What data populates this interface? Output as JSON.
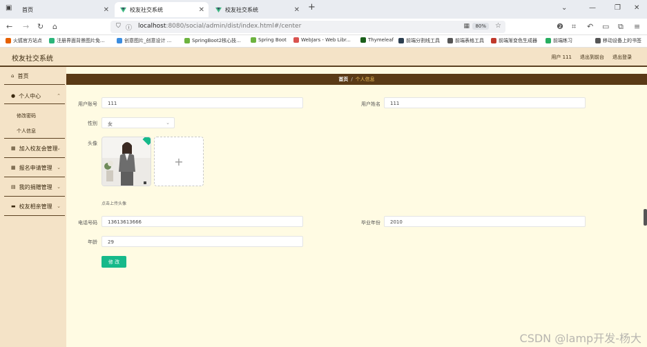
{
  "browser": {
    "tabs": [
      {
        "label": "首页"
      },
      {
        "label": "校友社交系统"
      },
      {
        "label": "校友社交系统"
      }
    ],
    "url_host": "localhost",
    "url_rest": ":8080/social/admin/dist/index.html#/center",
    "zoom": "80%",
    "bookmarks": [
      {
        "label": "火狐官方站点",
        "color": "#e66000"
      },
      {
        "label": "注册界面背景图片免...",
        "color": "#2bb57a"
      },
      {
        "label": "创意图片_创意设计 ...",
        "color": "#3b8de0"
      },
      {
        "label": "SpringBoot2核心技...",
        "color": "#6db33f"
      },
      {
        "label": "Spring Boot",
        "color": "#6db33f"
      },
      {
        "label": "WebJars - Web Libr...",
        "color": "#d9534f"
      },
      {
        "label": "Thymeleaf",
        "color": "#1a5f1a"
      },
      {
        "label": "前端分割线工具",
        "color": "#2c3e50"
      },
      {
        "label": "前端表格工具",
        "color": "#555555"
      },
      {
        "label": "前端渐变色生成器",
        "color": "#c0392b"
      },
      {
        "label": "前端练习",
        "color": "#27ae60"
      },
      {
        "label": "移动设备上的书签",
        "color": "#555555"
      }
    ]
  },
  "app": {
    "title": "校友社交系统",
    "header_links": {
      "user": "用户 111",
      "front": "退出到前台",
      "logout": "退出登录"
    }
  },
  "sidebar": {
    "home": "首页",
    "personal_center": "个人中心",
    "change_password": "修改密码",
    "personal_info": "个人信息",
    "join_association": "加入校友会管理",
    "signup_apply": "报名申请管理",
    "my_invites": "我的捐赠管理",
    "alumni_gathering": "校友相亲管理"
  },
  "breadcrumb": {
    "home": "首页",
    "separator": "/",
    "current": "个人信息"
  },
  "form": {
    "account_label": "用户账号",
    "account_value": "111",
    "name_label": "用户姓名",
    "name_value": "111",
    "gender_label": "性别",
    "gender_value": "女",
    "avatar_label": "头像",
    "avatar_hint": "点击上传头像",
    "phone_label": "电话号码",
    "phone_value": "13613613666",
    "grad_year_label": "毕业年份",
    "grad_year_value": "2010",
    "age_label": "年龄",
    "age_value": "29",
    "submit_label": "修 改"
  },
  "watermark": "CSDN @lamp开发-杨大"
}
